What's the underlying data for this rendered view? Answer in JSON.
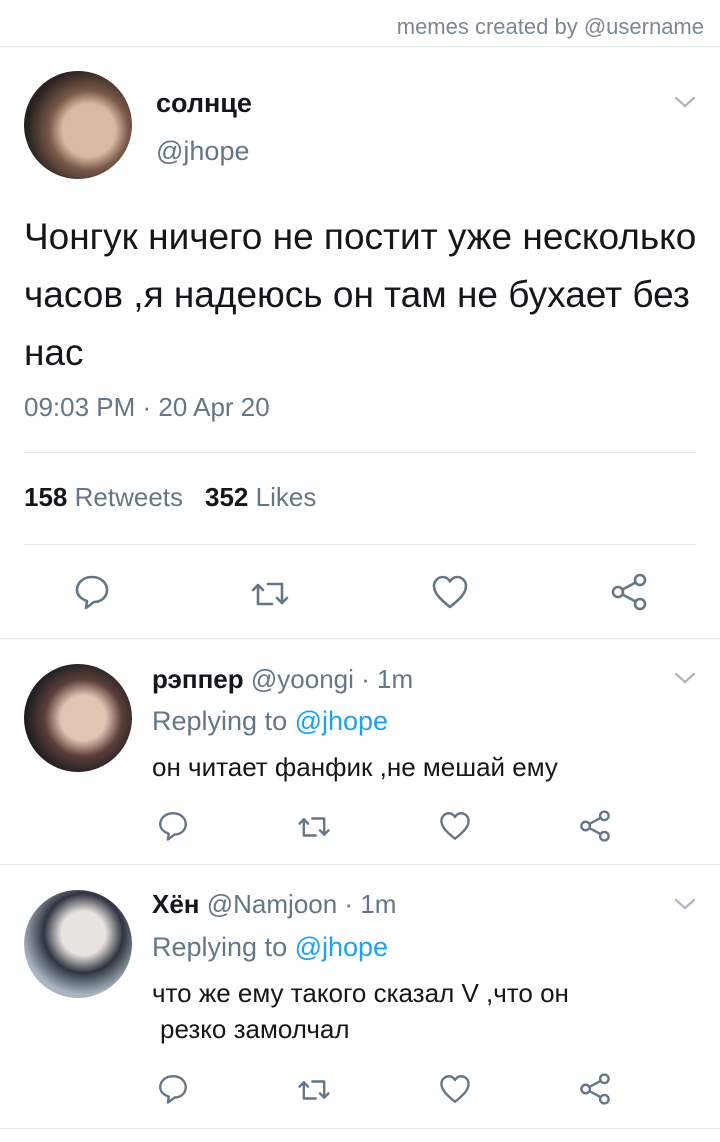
{
  "watermark": "memes created by @username",
  "main_tweet": {
    "display_name": "солнце",
    "handle": "@jhope",
    "text": "Чонгук ничего не постит уже несколько часов ,я надеюсь он там не бухает без нас",
    "timestamp": "09:03 PM · 20 Apr 20",
    "retweets_count": "158",
    "retweets_label": "Retweets",
    "likes_count": "352",
    "likes_label": "Likes"
  },
  "replies": [
    {
      "display_name": "рэппер",
      "meta": "@yoongi · 1m",
      "replying_prefix": "Replying to ",
      "replying_to": "@jhope",
      "text": "он читает фанфик ,не мешай ему"
    },
    {
      "display_name": "Хён",
      "meta": "@Namjoon · 1m",
      "replying_prefix": "Replying to ",
      "replying_to": "@jhope",
      "text_line1": "что же ему такого сказал V ,что он",
      "text_line2": "резко замолчал"
    }
  ],
  "colors": {
    "text_primary": "#14171a",
    "text_secondary": "#657786",
    "link": "#1da1f2",
    "icon": "#657786",
    "divider": "#dfe4e8"
  },
  "icons": [
    "chevron-down-icon",
    "reply-icon",
    "retweet-icon",
    "like-icon",
    "share-icon"
  ]
}
